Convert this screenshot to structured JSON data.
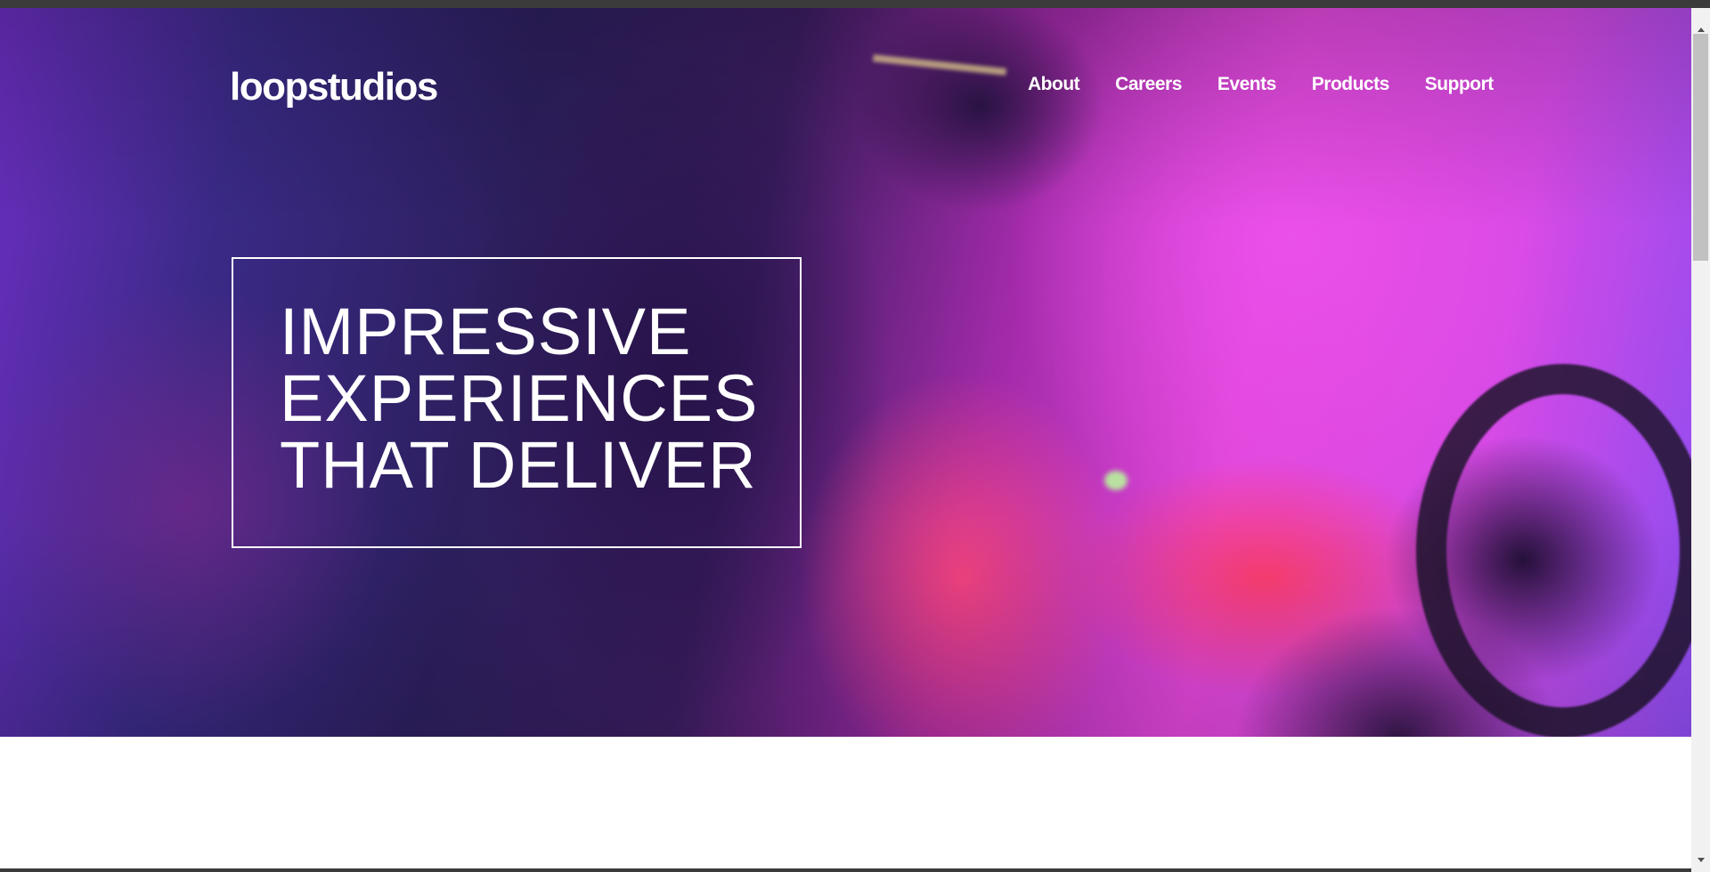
{
  "header": {
    "logo": "loopstudios",
    "nav": [
      "About",
      "Careers",
      "Events",
      "Products",
      "Support"
    ]
  },
  "hero": {
    "headline_lines": [
      "IMPRESSIVE",
      "EXPERIENCES",
      "THAT DELIVER"
    ],
    "image": "vr-gamer-photo"
  },
  "colors": {
    "text": "#ffffff",
    "hero_dark": "#2d1f5e",
    "hero_magenta": "#e046d8",
    "hero_red": "#ff3c64"
  }
}
